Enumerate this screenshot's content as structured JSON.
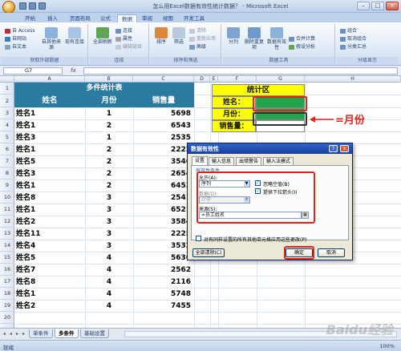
{
  "window": {
    "title": "怎么用Excel数据有效性统计数据？ - Microsoft Excel",
    "controls": [
      "–",
      "□",
      "×"
    ]
  },
  "tabs": [
    "开始",
    "插入",
    "页面布局",
    "公式",
    "数据",
    "审阅",
    "视图",
    "开发工具"
  ],
  "active_tab": "数据",
  "ribbon": {
    "groups": [
      {
        "label": "获取外部数据",
        "buttons": [
          "自 Access",
          "自网站",
          "自文本",
          "自其他来源",
          "现有连接"
        ]
      },
      {
        "label": "连接",
        "buttons": [
          "全部刷新",
          "连接",
          "属性",
          "编辑链接"
        ]
      },
      {
        "label": "排序和筛选",
        "buttons": [
          "排序",
          "筛选",
          "清除",
          "重新应用",
          "高级"
        ]
      },
      {
        "label": "数据工具",
        "buttons": [
          "分列",
          "删除重复项",
          "数据有效性",
          "合并计算",
          "假设分析"
        ]
      },
      {
        "label": "分级显示",
        "buttons": [
          "组合",
          "取消组合",
          "分类汇总"
        ]
      }
    ]
  },
  "formula_bar": {
    "name_box": "G7",
    "fx": "fx",
    "value": ""
  },
  "columns": [
    "A",
    "B",
    "C",
    "D",
    "E",
    "F",
    "G",
    "H"
  ],
  "rows": [
    "1",
    "2",
    "3",
    "4",
    "5",
    "6",
    "7",
    "8",
    "9",
    "10",
    "11",
    "12",
    "13",
    "14",
    "15",
    "16",
    "17",
    "18",
    "19",
    "20",
    "21"
  ],
  "table": {
    "title": "多件统计表",
    "headers": [
      "姓名",
      "月份",
      "销售量"
    ],
    "rows": [
      [
        "姓名1",
        "1",
        "5698"
      ],
      [
        "姓名1",
        "2",
        "6543"
      ],
      [
        "姓名3",
        "1",
        "2535"
      ],
      [
        "姓名1",
        "2",
        "2222"
      ],
      [
        "姓名5",
        "2",
        "3546"
      ],
      [
        "姓名3",
        "2",
        "2654"
      ],
      [
        "姓名1",
        "2",
        "6453"
      ],
      [
        "姓名8",
        "3",
        "2541"
      ],
      [
        "姓名1",
        "3",
        "6521"
      ],
      [
        "姓名2",
        "3",
        "3584"
      ],
      [
        "姓名11",
        "3",
        "2225"
      ],
      [
        "姓名4",
        "3",
        "3532"
      ],
      [
        "姓名5",
        "4",
        "5636"
      ],
      [
        "姓名7",
        "4",
        "2562"
      ],
      [
        "姓名8",
        "4",
        "2116"
      ],
      [
        "姓名1",
        "4",
        "5748"
      ],
      [
        "姓名2",
        "4",
        "7455"
      ]
    ]
  },
  "stats": {
    "title": "统计区",
    "name_label": "姓名：",
    "month_label": "月份：",
    "sales_label": "销售量："
  },
  "annotation": {
    "text": "=月份",
    "color": "#e2231a"
  },
  "dialog": {
    "title": "数据有效性",
    "tabs": [
      "设置",
      "输入信息",
      "出错警告",
      "输入法模式"
    ],
    "active_tab": "设置",
    "section_label": "有效性条件",
    "allow_label": "允许(A):",
    "allow_value": "序列",
    "ignore_blank": "忽略空值(B)",
    "dropdown": "提供下拉箭头(I)",
    "data_label": "数据(D):",
    "data_value": "介于",
    "source_label": "来源(S):",
    "source_value": "=员工姓名",
    "apply_all": "对有同样设置的所有其他单元格应用这些更改(P)",
    "clear_button": "全部清除(C)",
    "ok_button": "确定",
    "cancel_button": "取消"
  },
  "sheet_tabs": [
    "单条件",
    "多条件",
    "基础设置"
  ],
  "active_sheet": "多条件",
  "status": {
    "text": "就绪",
    "zoom": "100%"
  },
  "watermark": "Baidu经验",
  "colors": {
    "header_blue": "#2b7ba0",
    "stat_yellow": "#ffff00",
    "stat_green": "#22a54a",
    "highlight_red": "#e2231a"
  }
}
